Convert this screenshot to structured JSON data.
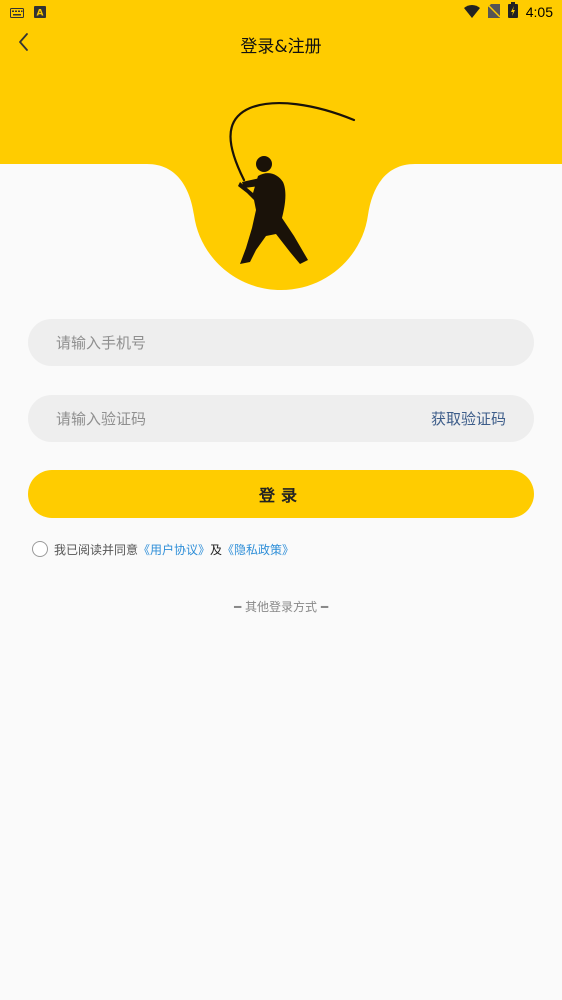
{
  "status_bar": {
    "time": "4:05",
    "left_icons": [
      "keyboard-icon",
      "a-notification-icon"
    ],
    "right_icons": [
      "wifi-icon",
      "no-sim-icon",
      "battery-charging-icon"
    ]
  },
  "header": {
    "title": "登录&注册",
    "back_icon": "chevron-left-icon",
    "accent_color": "#ffcc00"
  },
  "form": {
    "phone_placeholder": "请输入手机号",
    "phone_value": "",
    "code_placeholder": "请输入验证码",
    "code_value": "",
    "get_code_label": "获取验证码",
    "login_label": "登录"
  },
  "agreement": {
    "checked": false,
    "prefix": "我已阅读并同意",
    "user_agreement": "《用户协议》",
    "and": "及",
    "privacy_policy": "《隐私政策》"
  },
  "other_login": {
    "label": "其他登录方式"
  }
}
